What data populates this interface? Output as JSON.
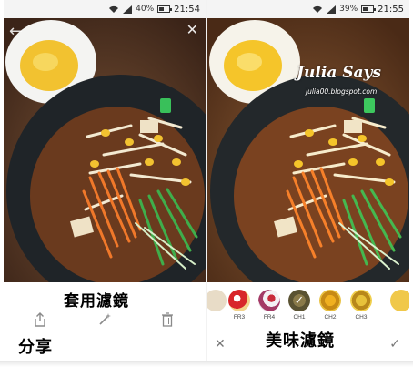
{
  "left_screen": {
    "status": {
      "battery": "40%",
      "time": "21:54"
    },
    "caption_top": "套用濾鏡",
    "caption_bottom": "分享",
    "toolbar": {
      "share_icon": "share-icon",
      "wand_icon": "magic-wand-icon",
      "trash_icon": "trash-icon"
    }
  },
  "right_screen": {
    "status": {
      "battery": "39%",
      "time": "21:55"
    },
    "watermark": {
      "title": "Julia Says",
      "url": "julia00.blogspot.com"
    },
    "filters": [
      {
        "label": "FR3",
        "selected": false
      },
      {
        "label": "FR4",
        "selected": false
      },
      {
        "label": "CH1",
        "selected": true
      },
      {
        "label": "CH2",
        "selected": false
      },
      {
        "label": "CH3",
        "selected": false
      }
    ],
    "caption": "美味濾鏡"
  },
  "colors": {
    "accent_yellow": "#f2c230",
    "bowl": "#1f2428",
    "carrot": "#f0782a",
    "cucumber": "#3fae4b"
  }
}
